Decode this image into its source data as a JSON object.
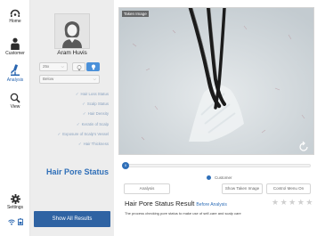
{
  "nav": {
    "items": [
      {
        "label": "Home",
        "icon": "home-icon"
      },
      {
        "label": "Customer",
        "icon": "person-icon"
      },
      {
        "label": "Analysis",
        "icon": "microscope-icon",
        "active": true
      },
      {
        "label": "View",
        "icon": "magnify-icon"
      }
    ],
    "settings_label": "Settings",
    "bottom_icons": [
      "wifi-icon",
      "battery-icon"
    ]
  },
  "profile": {
    "name": "Aram Huvis",
    "magnification": "25x",
    "view_select": "Below"
  },
  "status_items": [
    "Hair Loss Status",
    "Scalp Status",
    "Hair Density",
    "Keratin of Scalp",
    "Exposure of Scalp's Vessel",
    "Hair Thickness"
  ],
  "section_title": "Hair Pore Status",
  "show_all_label": "Show All Results",
  "image": {
    "tag": "Taken Image"
  },
  "slider": {
    "knob_label": "0",
    "value": 0
  },
  "radio": {
    "label": "Customer"
  },
  "buttons": {
    "analysis": "Analysis",
    "show_taken": "Show Taken Image",
    "control_menu": "Control Menu On"
  },
  "result": {
    "title": "Hair Pore Status Result",
    "subtitle": "Before Analysis",
    "description": "The process checking pore status to make use of self-care and scalp care",
    "rating": 0,
    "rating_max": 5
  },
  "colors": {
    "accent": "#2f6fb8",
    "button_dark": "#2f63a3",
    "panel": "#ededed"
  }
}
